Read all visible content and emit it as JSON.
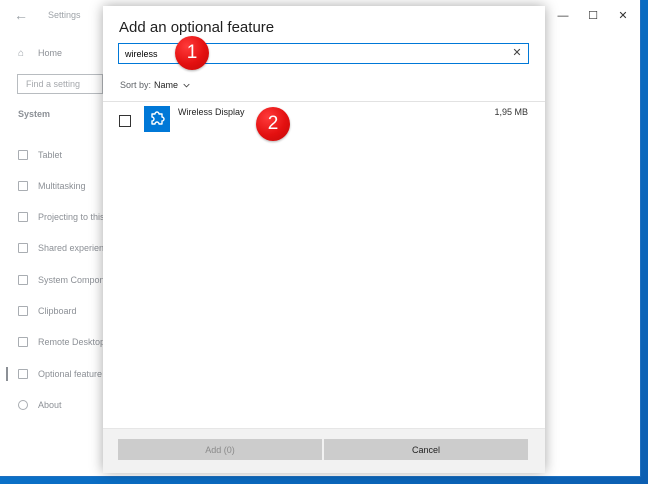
{
  "settings": {
    "title": "Settings",
    "sidebar": {
      "home": "Home",
      "find_placeholder": "Find a setting",
      "section": "System",
      "items": [
        {
          "label": "Tablet"
        },
        {
          "label": "Multitasking"
        },
        {
          "label": "Projecting to this PC"
        },
        {
          "label": "Shared experiences"
        },
        {
          "label": "System Components"
        },
        {
          "label": "Clipboard"
        },
        {
          "label": "Remote Desktop"
        },
        {
          "label": "Optional features"
        },
        {
          "label": "About"
        }
      ]
    }
  },
  "dialog": {
    "title": "Add an optional feature",
    "search_value": "wireless",
    "sort_label": "Sort by:",
    "sort_value": "Name",
    "features": [
      {
        "name": "Wireless Display",
        "size": "1,95 MB",
        "icon": "puzzle-icon"
      }
    ],
    "add_label": "Add (0)",
    "cancel_label": "Cancel"
  },
  "markers": [
    "1",
    "2"
  ],
  "colors": {
    "accent": "#0078d7",
    "marker": "#e31010",
    "desktop": "#0a72c8"
  }
}
